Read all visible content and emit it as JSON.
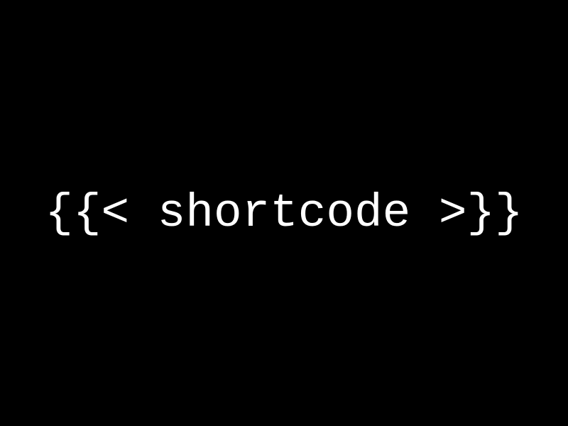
{
  "main": {
    "text": "{{< shortcode >}}"
  }
}
